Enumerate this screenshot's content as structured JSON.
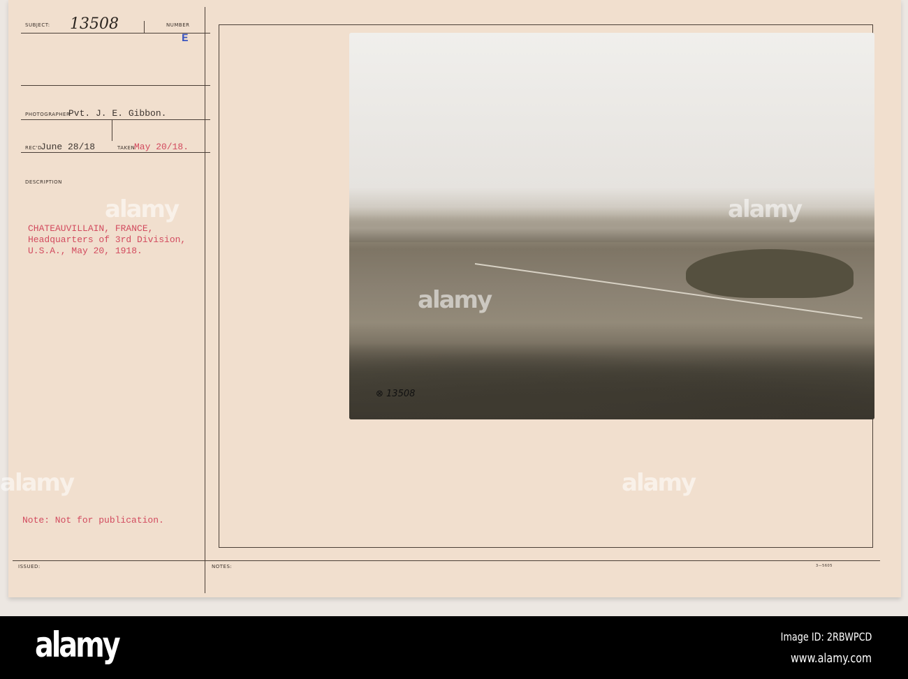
{
  "card": {
    "subject_label": "SUBJECT:",
    "number_label": "NUMBER",
    "subject_number": "13508",
    "number_letter": "E",
    "photographer_label": "PHOTOGRAPHER",
    "photographer": "Pvt. J. E. Gibbon.",
    "recd_label": "REC'D",
    "recd": "June 28/18",
    "taken_label": "TAKEN",
    "taken": "May 20/18.",
    "description_label": "DESCRIPTION",
    "description": [
      "CHATEAUVILLAIN, FRANCE,",
      "Headquarters of 3rd Division,",
      "U.S.A., May 20, 1918."
    ],
    "note": "Note: Not for publication.",
    "issued_label": "ISSUED:",
    "notes_label": "NOTES:",
    "form_number": "3—5605",
    "photo_number": "13508"
  },
  "watermark": {
    "logo": "alamy",
    "letter": "a"
  },
  "footer": {
    "logo": "alamy",
    "image_id": "Image ID: 2RBWPCD",
    "url": "www.alamy.com"
  }
}
